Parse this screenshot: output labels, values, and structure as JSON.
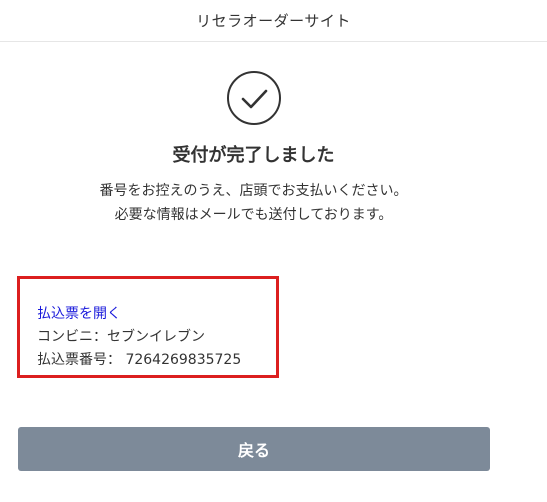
{
  "header": {
    "title": "リセラオーダーサイト"
  },
  "main": {
    "icon": "check-circle-icon",
    "heading": "受付が完了しました",
    "message_line1": "番号をお控えのうえ、店頭でお支払いください。",
    "message_line2": "必要な情報はメールでも送付しております。"
  },
  "payment": {
    "link_label": "払込票を開く",
    "store_label": "コンビニ：",
    "store_value": "セブンイレブン",
    "number_label": "払込票番号：",
    "number_value": "7264269835725",
    "highlight_color": "#dc1f1f",
    "link_color": "#1a1adb"
  },
  "actions": {
    "back_label": "戻る",
    "button_color": "#7d8a99"
  }
}
